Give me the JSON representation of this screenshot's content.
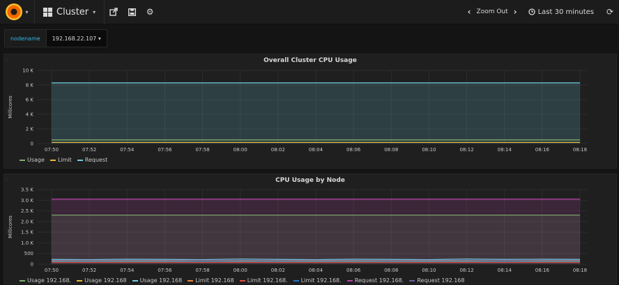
{
  "topbar": {
    "dashboard_title": "Cluster",
    "zoom_out_label": "Zoom Out",
    "time_range_label": "Last 30 minutes"
  },
  "variables": [
    {
      "label": "nodename",
      "value": "192.168.22.107"
    }
  ],
  "colors": {
    "usage": "#7eb26d",
    "limit": "#eab839",
    "request": "#6ed0e0",
    "orange": "#ef843c",
    "red": "#e24d42",
    "blue": "#1f78c1",
    "purple": "#ba43a9",
    "violet": "#705da0"
  },
  "chart_data": [
    {
      "type": "line",
      "title": "Overall Cluster CPU Usage",
      "ylabel": "Millicores",
      "xlabel": "",
      "x_ticks": [
        "07:50",
        "07:52",
        "07:54",
        "07:56",
        "07:58",
        "08:00",
        "08:02",
        "08:04",
        "08:06",
        "08:08",
        "08:10",
        "08:12",
        "08:14",
        "08:16",
        "08:18"
      ],
      "y_ticks": [
        "0",
        "2 K",
        "4 K",
        "6 K",
        "8 K",
        "10 K"
      ],
      "ylim": [
        0,
        10000
      ],
      "series": [
        {
          "name": "Usage",
          "color_key": "usage",
          "values": [
            500,
            500,
            500,
            500,
            500,
            500,
            500,
            500,
            500,
            500,
            500,
            500,
            500,
            500,
            500
          ]
        },
        {
          "name": "Limit",
          "color_key": "limit",
          "values": [
            150,
            150,
            150,
            150,
            150,
            150,
            150,
            150,
            150,
            150,
            150,
            150,
            150,
            150,
            150
          ]
        },
        {
          "name": "Request",
          "color_key": "request",
          "values": [
            8300,
            8300,
            8300,
            8300,
            8300,
            8300,
            8300,
            8300,
            8300,
            8300,
            8300,
            8300,
            8300,
            8300,
            8300
          ]
        }
      ]
    },
    {
      "type": "line",
      "title": "CPU Usage by Node",
      "ylabel": "Millicores",
      "xlabel": "",
      "x_ticks": [
        "07:50",
        "07:52",
        "07:54",
        "07:56",
        "07:58",
        "08:00",
        "08:02",
        "08:04",
        "08:06",
        "08:08",
        "08:10",
        "08:12",
        "08:14",
        "08:16",
        "08:18"
      ],
      "y_ticks": [
        "0",
        "500",
        "1.0 K",
        "1.5 K",
        "2.0 K",
        "2.5 K",
        "3.0 K",
        "3.5 K"
      ],
      "ylim": [
        0,
        3500
      ],
      "series": [
        {
          "name": "Usage 192.168.",
          "color_key": "usage",
          "values": [
            2300,
            2300,
            2300,
            2300,
            2300,
            2300,
            2300,
            2300,
            2300,
            2300,
            2300,
            2300,
            2300,
            2300,
            2300
          ]
        },
        {
          "name": "Usage 192.168",
          "color_key": "limit",
          "values": [
            150,
            160,
            150,
            150,
            170,
            150,
            160,
            150,
            150,
            160,
            150,
            150,
            170,
            150,
            150
          ]
        },
        {
          "name": "Usage 192.168",
          "color_key": "request",
          "values": [
            220,
            210,
            230,
            220,
            210,
            240,
            220,
            210,
            230,
            220,
            210,
            240,
            220,
            230,
            220
          ]
        },
        {
          "name": "Limit 192.168",
          "color_key": "orange",
          "values": [
            100,
            100,
            100,
            100,
            100,
            100,
            100,
            100,
            100,
            100,
            100,
            100,
            100,
            100,
            100
          ]
        },
        {
          "name": "Limit 192.168.",
          "color_key": "red",
          "values": [
            80,
            80,
            80,
            80,
            80,
            80,
            80,
            80,
            80,
            80,
            80,
            80,
            80,
            80,
            80
          ]
        },
        {
          "name": "Limit 192.168.",
          "color_key": "blue",
          "values": [
            120,
            120,
            120,
            120,
            120,
            120,
            120,
            120,
            120,
            120,
            120,
            120,
            120,
            120,
            120
          ]
        },
        {
          "name": "Request 192.168.",
          "color_key": "purple",
          "values": [
            3050,
            3050,
            3050,
            3050,
            3050,
            3050,
            3050,
            3050,
            3050,
            3050,
            3050,
            3050,
            3050,
            3050,
            3050
          ]
        },
        {
          "name": "Request 192.168",
          "color_key": "violet",
          "values": [
            180,
            180,
            180,
            180,
            180,
            180,
            180,
            180,
            180,
            180,
            180,
            180,
            180,
            180,
            180
          ]
        }
      ]
    }
  ]
}
